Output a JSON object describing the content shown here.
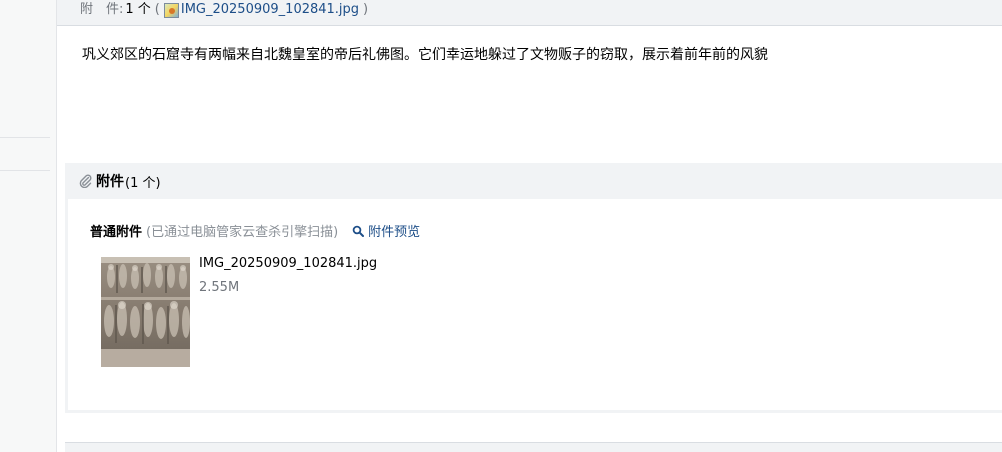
{
  "header": {
    "attachment_label": "附　件:",
    "attachment_count": "1 个",
    "paren_open": "(",
    "paren_close": ")",
    "file_name": "IMG_20250909_102841.jpg"
  },
  "body": {
    "text": "巩义郊区的石窟寺有两幅来自北魏皇室的帝后礼佛图。它们幸运地躲过了文物贩子的窃取，展示着前年前的风貌"
  },
  "attachments": {
    "title": "附件",
    "count": "(1 个)",
    "type_label": "普通附件",
    "scan_note": "(已通过电脑管家云查杀引擎扫描)",
    "preview_label": "附件预览",
    "file": {
      "name": "IMG_20250909_102841.jpg",
      "size": "2.55M"
    }
  },
  "icons": {
    "file_type": "image-file-icon",
    "clip": "paperclip-icon",
    "preview": "search-icon"
  },
  "colors": {
    "link": "#1d4e88",
    "muted": "#70757c",
    "panel_bg": "#f1f3f5"
  }
}
